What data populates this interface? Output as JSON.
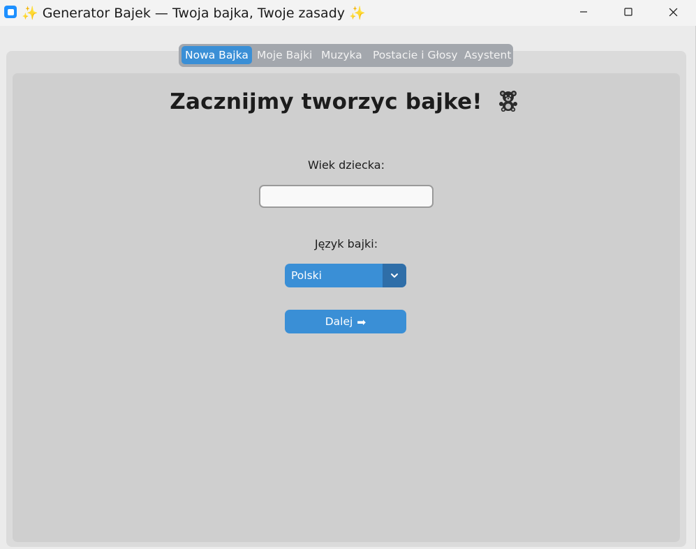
{
  "window": {
    "title": "✨ Generator Bajek — Twoja bajka, Twoje zasady ✨",
    "controls": [
      "minimize-icon",
      "maximize-icon",
      "close-icon"
    ]
  },
  "tabs": [
    {
      "label": "Nowa Bajka",
      "active": true
    },
    {
      "label": "Moje Bajki",
      "active": false
    },
    {
      "label": "Muzyka",
      "active": false
    },
    {
      "label": "Postacie i Głosy",
      "active": false
    },
    {
      "label": "Asystent",
      "active": false
    }
  ],
  "main": {
    "heading": "Zacznijmy tworzyc bajke!",
    "heading_icon": "teddy-bear-icon",
    "age_label": "Wiek dziecka:",
    "age_value": "",
    "language_label": "Język bajki:",
    "language_selected": "Polski",
    "next_button_label": "Dalej",
    "next_button_icon": "➡"
  },
  "colors": {
    "accent": "#3a8fd6",
    "accent_dark": "#2f6ea8",
    "tabbar_bg": "#a3a7ad",
    "panel_bg": "#cfcfcf"
  }
}
